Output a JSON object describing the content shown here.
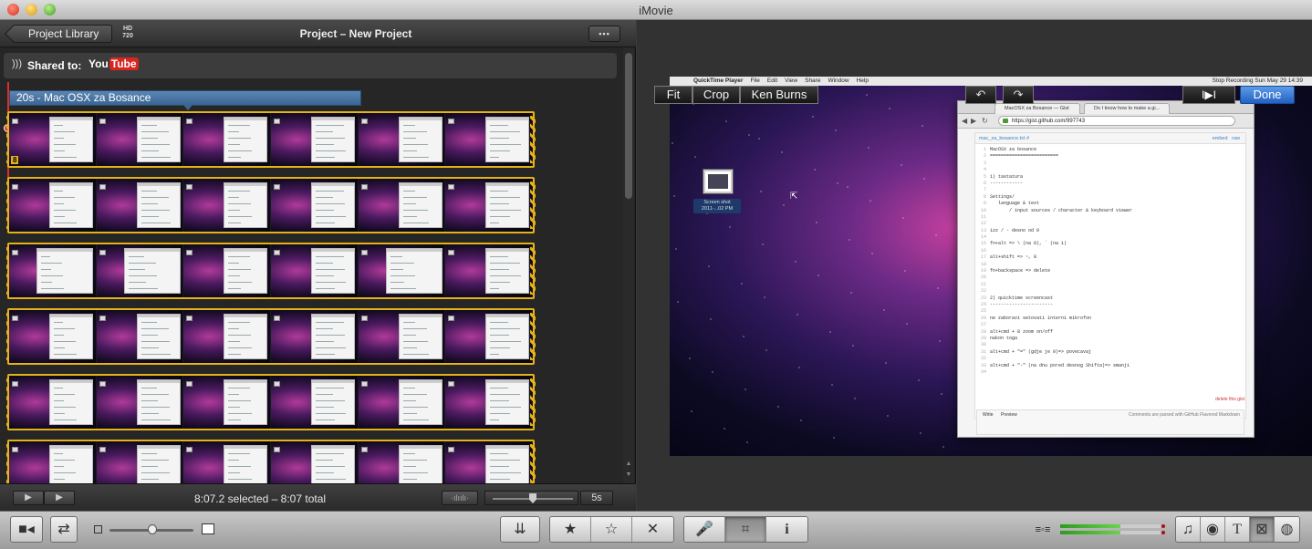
{
  "window": {
    "title": "iMovie",
    "controls": {
      "close": "×",
      "minimize": "–",
      "zoom": "+"
    }
  },
  "project_header": {
    "back_label": "Project Library",
    "hd_badge": "HD 720",
    "title": "Project – New Project",
    "view_label": "▪▪▪"
  },
  "shared": {
    "label": "Shared to:",
    "service_you": "You",
    "service_tube": "Tube"
  },
  "clip": {
    "title": "20s - Mac OSX za Bosance",
    "count_badge": "8"
  },
  "bottom_bar": {
    "play_full": "▶",
    "play": "▶",
    "status": "8:07.2 selected – 8:07 total",
    "zoom_value": "5s"
  },
  "viewer": {
    "fit_label": "Fit",
    "crop_label": "Crop",
    "kenburns_label": "Ken Burns",
    "undo_label": "↶",
    "redo_label": "↷",
    "skip_label": "I▶I",
    "done_label": "Done"
  },
  "screenshot": {
    "menubar": [
      "QuickTime Player",
      "File",
      "Edit",
      "View",
      "Share",
      "Window",
      "Help"
    ],
    "menubar_right": "Stop Recording   Sun May 29  14:39",
    "desktop_icon_label": "Screen shot 2011-...02 PM",
    "tabs": [
      "MacOSX za Bosance — Gist",
      "Do I know how to make a gi..."
    ],
    "url": "https://gist.github.com/997743",
    "gist_file": "mac_za_bosance.txt #",
    "gist_embed": "embed",
    "gist_raw": "raw",
    "code_lines": [
      {
        "n": "1",
        "t": "MacOSX za bosance"
      },
      {
        "n": "2",
        "t": "========================="
      },
      {
        "n": "3",
        "t": ""
      },
      {
        "n": "4",
        "t": ""
      },
      {
        "n": "5",
        "t": "1) tastatura"
      },
      {
        "n": "6",
        "t": "------------"
      },
      {
        "n": "7",
        "t": ""
      },
      {
        "n": "8",
        "t": "Settings/"
      },
      {
        "n": "9",
        "t": "   language & text"
      },
      {
        "n": "10",
        "t": "       / input sources / character & keyboard viewer"
      },
      {
        "n": "11",
        "t": ""
      },
      {
        "n": "12",
        "t": ""
      },
      {
        "n": "13",
        "t": "izz / - desno od 0"
      },
      {
        "n": "14",
        "t": ""
      },
      {
        "n": "15",
        "t": "fn+alt => \\ (na 8), ` (na 1)"
      },
      {
        "n": "16",
        "t": ""
      },
      {
        "n": "17",
        "t": "alt+shift => ~, 8"
      },
      {
        "n": "18",
        "t": ""
      },
      {
        "n": "19",
        "t": "fn+backspace => delete"
      },
      {
        "n": "20",
        "t": ""
      },
      {
        "n": "21",
        "t": ""
      },
      {
        "n": "22",
        "t": ""
      },
      {
        "n": "23",
        "t": "2) quicktime screencast"
      },
      {
        "n": "24",
        "t": "-----------------------"
      },
      {
        "n": "25",
        "t": ""
      },
      {
        "n": "26",
        "t": "ne zaboravi setovati interni mikrofon"
      },
      {
        "n": "27",
        "t": ""
      },
      {
        "n": "28",
        "t": "alt+cmd + 8 zoom on/off"
      },
      {
        "n": "29",
        "t": "nakon toga"
      },
      {
        "n": "30",
        "t": ""
      },
      {
        "n": "31",
        "t": "alt+cmd + \"=\" (gdje je 0)=> povecavaj"
      },
      {
        "n": "32",
        "t": ""
      },
      {
        "n": "33",
        "t": "alt+cmd + \"-\" (na dnu pored desnog Shifta)=> smanji"
      },
      {
        "n": "34",
        "t": ""
      }
    ],
    "delete_link": "delete this gist",
    "comment_write": "Write",
    "comment_preview": "Preview",
    "comment_note": "Comments are parsed with GitHub Flavored Markdown"
  },
  "toolbar": {
    "camera_icon": "■◂",
    "swap_icon": "⇄",
    "import_icon": "⇊",
    "star_full": "★",
    "star_empty": "☆",
    "reject": "✕",
    "mic": "🎤",
    "crop": "⌗",
    "info": "i",
    "audio_adjust": "≡◦≡",
    "music": "♫",
    "photo": "◉",
    "title": "T",
    "transition": "⊠",
    "map": "◍"
  }
}
